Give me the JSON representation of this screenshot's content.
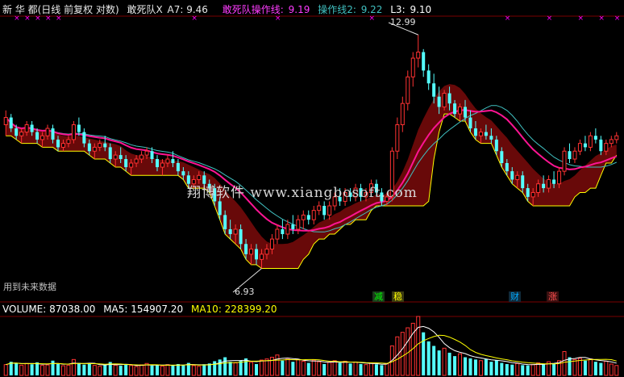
{
  "header": {
    "title": "新 华 都(日线 前复权 对数)",
    "ind1_label": "敢死队X",
    "ind1_value": "A7: 9.46",
    "ind2_label": "敢死队操作线:",
    "ind2_value": "9.19",
    "ind3_label": "操作线2:",
    "ind3_value": "9.22",
    "ind4_label": "L3:",
    "ind4_value": "9.10"
  },
  "volume_header": {
    "volume": "VOLUME: 87038.00",
    "ma5": "MA5: 154907.20",
    "ma10": "MA10: 228399.20"
  },
  "watermark": "翔博软件 www.xiangbosoft.com",
  "future_note": "用到未来数据",
  "high_label": "12.99",
  "low_label": "6.93",
  "signals": [
    {
      "text": "减",
      "color": "#00ff00"
    },
    {
      "text": "稳",
      "color": "#ffff00"
    },
    {
      "text": "财",
      "color": "#00aaff"
    },
    {
      "text": "涨",
      "color": "#ff5050"
    }
  ],
  "colors": {
    "up": "#ff3232",
    "down": "#54ffff",
    "band": "#7a0a0a",
    "ma_pink": "#ff1493",
    "ma_cyan": "#40c0c0",
    "yellow": "#ffff00",
    "grid": "#7a0000",
    "magenta": "#ff00ff"
  },
  "chart_data": [
    {
      "type": "candlestick",
      "title": "新 华 都(日线 前复权 对数)",
      "scale": "log",
      "ylim": [
        6.5,
        13.6
      ],
      "annotations": [
        {
          "text": "12.99",
          "value": 12.99
        },
        {
          "text": "6.93",
          "value": 6.93
        }
      ],
      "ohlc": [
        [
          10.2,
          10.6,
          9.9,
          10.4
        ],
        [
          10.4,
          10.5,
          10.0,
          10.1
        ],
        [
          10.1,
          10.2,
          9.8,
          9.9
        ],
        [
          9.9,
          10.1,
          9.7,
          10.0
        ],
        [
          10.0,
          10.3,
          9.9,
          10.2
        ],
        [
          10.2,
          10.3,
          9.9,
          10.0
        ],
        [
          10.0,
          10.1,
          9.7,
          9.8
        ],
        [
          9.8,
          10.0,
          9.6,
          9.9
        ],
        [
          9.9,
          10.2,
          9.8,
          10.1
        ],
        [
          10.1,
          10.2,
          9.7,
          9.8
        ],
        [
          9.8,
          9.9,
          9.5,
          9.6
        ],
        [
          9.6,
          9.8,
          9.5,
          9.7
        ],
        [
          9.7,
          9.9,
          9.6,
          9.8
        ],
        [
          9.8,
          10.3,
          9.7,
          10.2
        ],
        [
          10.2,
          10.4,
          9.9,
          10.0
        ],
        [
          10.0,
          10.1,
          9.6,
          9.7
        ],
        [
          9.7,
          9.8,
          9.4,
          9.5
        ],
        [
          9.5,
          9.7,
          9.3,
          9.6
        ],
        [
          9.6,
          9.8,
          9.5,
          9.7
        ],
        [
          9.7,
          9.9,
          9.5,
          9.6
        ],
        [
          9.6,
          9.7,
          9.2,
          9.3
        ],
        [
          9.3,
          9.5,
          9.1,
          9.4
        ],
        [
          9.4,
          9.6,
          9.2,
          9.3
        ],
        [
          9.3,
          9.4,
          9.0,
          9.1
        ],
        [
          9.1,
          9.3,
          8.9,
          9.2
        ],
        [
          9.2,
          9.4,
          9.1,
          9.3
        ],
        [
          9.3,
          9.5,
          9.2,
          9.4
        ],
        [
          9.4,
          9.6,
          9.3,
          9.5
        ],
        [
          9.5,
          9.6,
          9.2,
          9.3
        ],
        [
          9.3,
          9.4,
          9.0,
          9.1
        ],
        [
          9.1,
          9.3,
          8.9,
          9.2
        ],
        [
          9.2,
          9.4,
          9.1,
          9.3
        ],
        [
          9.3,
          9.5,
          9.1,
          9.2
        ],
        [
          9.2,
          9.3,
          8.9,
          9.0
        ],
        [
          9.0,
          9.1,
          8.8,
          8.9
        ],
        [
          8.9,
          9.0,
          8.6,
          8.7
        ],
        [
          8.7,
          8.9,
          8.6,
          8.8
        ],
        [
          8.8,
          9.0,
          8.7,
          8.9
        ],
        [
          8.9,
          9.0,
          8.6,
          8.7
        ],
        [
          8.7,
          8.8,
          8.5,
          8.6
        ],
        [
          8.6,
          8.7,
          8.2,
          8.3
        ],
        [
          8.3,
          8.4,
          7.9,
          8.0
        ],
        [
          8.0,
          8.1,
          7.6,
          7.7
        ],
        [
          7.7,
          7.9,
          7.5,
          7.6
        ],
        [
          7.6,
          7.8,
          7.4,
          7.7
        ],
        [
          7.7,
          7.8,
          7.3,
          7.4
        ],
        [
          7.4,
          7.5,
          7.1,
          7.2
        ],
        [
          7.2,
          7.4,
          7.0,
          7.3
        ],
        [
          7.3,
          7.4,
          7.0,
          7.1
        ],
        [
          7.1,
          7.3,
          6.93,
          7.2
        ],
        [
          7.2,
          7.4,
          7.1,
          7.3
        ],
        [
          7.3,
          7.6,
          7.2,
          7.5
        ],
        [
          7.5,
          7.8,
          7.4,
          7.7
        ],
        [
          7.7,
          7.9,
          7.5,
          7.6
        ],
        [
          7.6,
          7.9,
          7.5,
          7.8
        ],
        [
          7.8,
          8.0,
          7.6,
          7.7
        ],
        [
          7.7,
          8.0,
          7.6,
          7.9
        ],
        [
          7.9,
          8.1,
          7.7,
          8.0
        ],
        [
          8.0,
          8.1,
          7.8,
          7.9
        ],
        [
          7.9,
          8.2,
          7.8,
          8.1
        ],
        [
          8.1,
          8.3,
          8.0,
          8.2
        ],
        [
          8.2,
          8.3,
          7.9,
          8.0
        ],
        [
          8.0,
          8.3,
          7.9,
          8.2
        ],
        [
          8.2,
          8.5,
          8.1,
          8.4
        ],
        [
          8.4,
          8.6,
          8.2,
          8.3
        ],
        [
          8.3,
          8.6,
          8.2,
          8.5
        ],
        [
          8.5,
          8.6,
          8.3,
          8.4
        ],
        [
          8.4,
          8.7,
          8.3,
          8.6
        ],
        [
          8.6,
          8.7,
          8.3,
          8.4
        ],
        [
          8.4,
          8.6,
          8.3,
          8.5
        ],
        [
          8.5,
          8.8,
          8.4,
          8.7
        ],
        [
          8.7,
          8.8,
          8.4,
          8.5
        ],
        [
          8.5,
          8.6,
          8.2,
          8.3
        ],
        [
          8.3,
          8.5,
          8.2,
          8.4
        ],
        [
          8.4,
          9.6,
          8.3,
          9.5
        ],
        [
          9.5,
          10.4,
          9.3,
          10.2
        ],
        [
          10.2,
          11.0,
          10.0,
          10.8
        ],
        [
          10.8,
          11.8,
          10.6,
          11.6
        ],
        [
          11.6,
          12.4,
          11.3,
          12.2
        ],
        [
          12.2,
          12.99,
          11.9,
          12.4
        ],
        [
          12.4,
          12.5,
          11.6,
          11.8
        ],
        [
          11.8,
          12.0,
          11.2,
          11.4
        ],
        [
          11.4,
          11.7,
          10.8,
          11.0
        ],
        [
          11.0,
          11.3,
          10.5,
          10.7
        ],
        [
          10.7,
          11.2,
          10.6,
          11.1
        ],
        [
          11.1,
          11.3,
          10.6,
          10.8
        ],
        [
          10.8,
          10.9,
          10.4,
          10.5
        ],
        [
          10.5,
          10.8,
          10.3,
          10.7
        ],
        [
          10.7,
          10.9,
          10.3,
          10.4
        ],
        [
          10.4,
          10.6,
          10.0,
          10.1
        ],
        [
          10.1,
          10.3,
          9.8,
          9.9
        ],
        [
          9.9,
          10.1,
          9.7,
          10.0
        ],
        [
          10.0,
          10.2,
          9.8,
          9.9
        ],
        [
          9.9,
          10.1,
          9.7,
          9.8
        ],
        [
          9.8,
          9.9,
          9.4,
          9.5
        ],
        [
          9.5,
          9.6,
          9.1,
          9.2
        ],
        [
          9.2,
          9.3,
          8.9,
          9.0
        ],
        [
          9.0,
          9.1,
          8.7,
          8.8
        ],
        [
          8.8,
          9.0,
          8.6,
          8.9
        ],
        [
          8.9,
          9.0,
          8.5,
          8.6
        ],
        [
          8.6,
          8.7,
          8.3,
          8.4
        ],
        [
          8.4,
          8.6,
          8.2,
          8.5
        ],
        [
          8.5,
          8.8,
          8.4,
          8.7
        ],
        [
          8.7,
          8.9,
          8.5,
          8.6
        ],
        [
          8.6,
          8.9,
          8.5,
          8.8
        ],
        [
          8.8,
          9.0,
          8.6,
          8.7
        ],
        [
          8.7,
          9.1,
          8.6,
          9.0
        ],
        [
          9.0,
          9.6,
          8.9,
          9.5
        ],
        [
          9.5,
          9.7,
          9.2,
          9.3
        ],
        [
          9.3,
          9.6,
          9.2,
          9.5
        ],
        [
          9.5,
          9.8,
          9.4,
          9.7
        ],
        [
          9.7,
          9.9,
          9.5,
          9.6
        ],
        [
          9.6,
          10.0,
          9.5,
          9.9
        ],
        [
          9.9,
          10.1,
          9.7,
          9.8
        ],
        [
          9.8,
          9.9,
          9.4,
          9.5
        ],
        [
          9.5,
          9.8,
          9.4,
          9.7
        ],
        [
          9.7,
          9.9,
          9.6,
          9.8
        ],
        [
          9.8,
          10.0,
          9.7,
          9.9
        ]
      ],
      "volume": [
        95000,
        120000,
        110000,
        90000,
        105000,
        98000,
        115000,
        88000,
        92000,
        130000,
        100000,
        85000,
        90000,
        140000,
        110000,
        95000,
        102000,
        88000,
        80000,
        96000,
        118000,
        90000,
        85000,
        99000,
        87000,
        78000,
        93000,
        105000,
        86000,
        90000,
        82000,
        95000,
        88000,
        100000,
        92000,
        110000,
        86000,
        80000,
        98000,
        105000,
        125000,
        140000,
        160000,
        120000,
        110000,
        130000,
        150000,
        115000,
        100000,
        135000,
        145000,
        160000,
        180000,
        130000,
        150000,
        120000,
        140000,
        125000,
        110000,
        135000,
        120000,
        100000,
        115000,
        130000,
        110000,
        125000,
        105000,
        118000,
        100000,
        95000,
        110000,
        98000,
        90000,
        105000,
        260000,
        340000,
        380000,
        420000,
        460000,
        520000,
        380000,
        300000,
        260000,
        220000,
        240000,
        200000,
        170000,
        190000,
        160000,
        150000,
        140000,
        130000,
        145000,
        120000,
        135000,
        110000,
        100000,
        95000,
        105000,
        90000,
        88000,
        96000,
        110000,
        100000,
        120000,
        105000,
        130000,
        210000,
        160000,
        140000,
        150000,
        130000,
        145000,
        120000,
        110000,
        125000,
        100000,
        87038
      ]
    }
  ]
}
